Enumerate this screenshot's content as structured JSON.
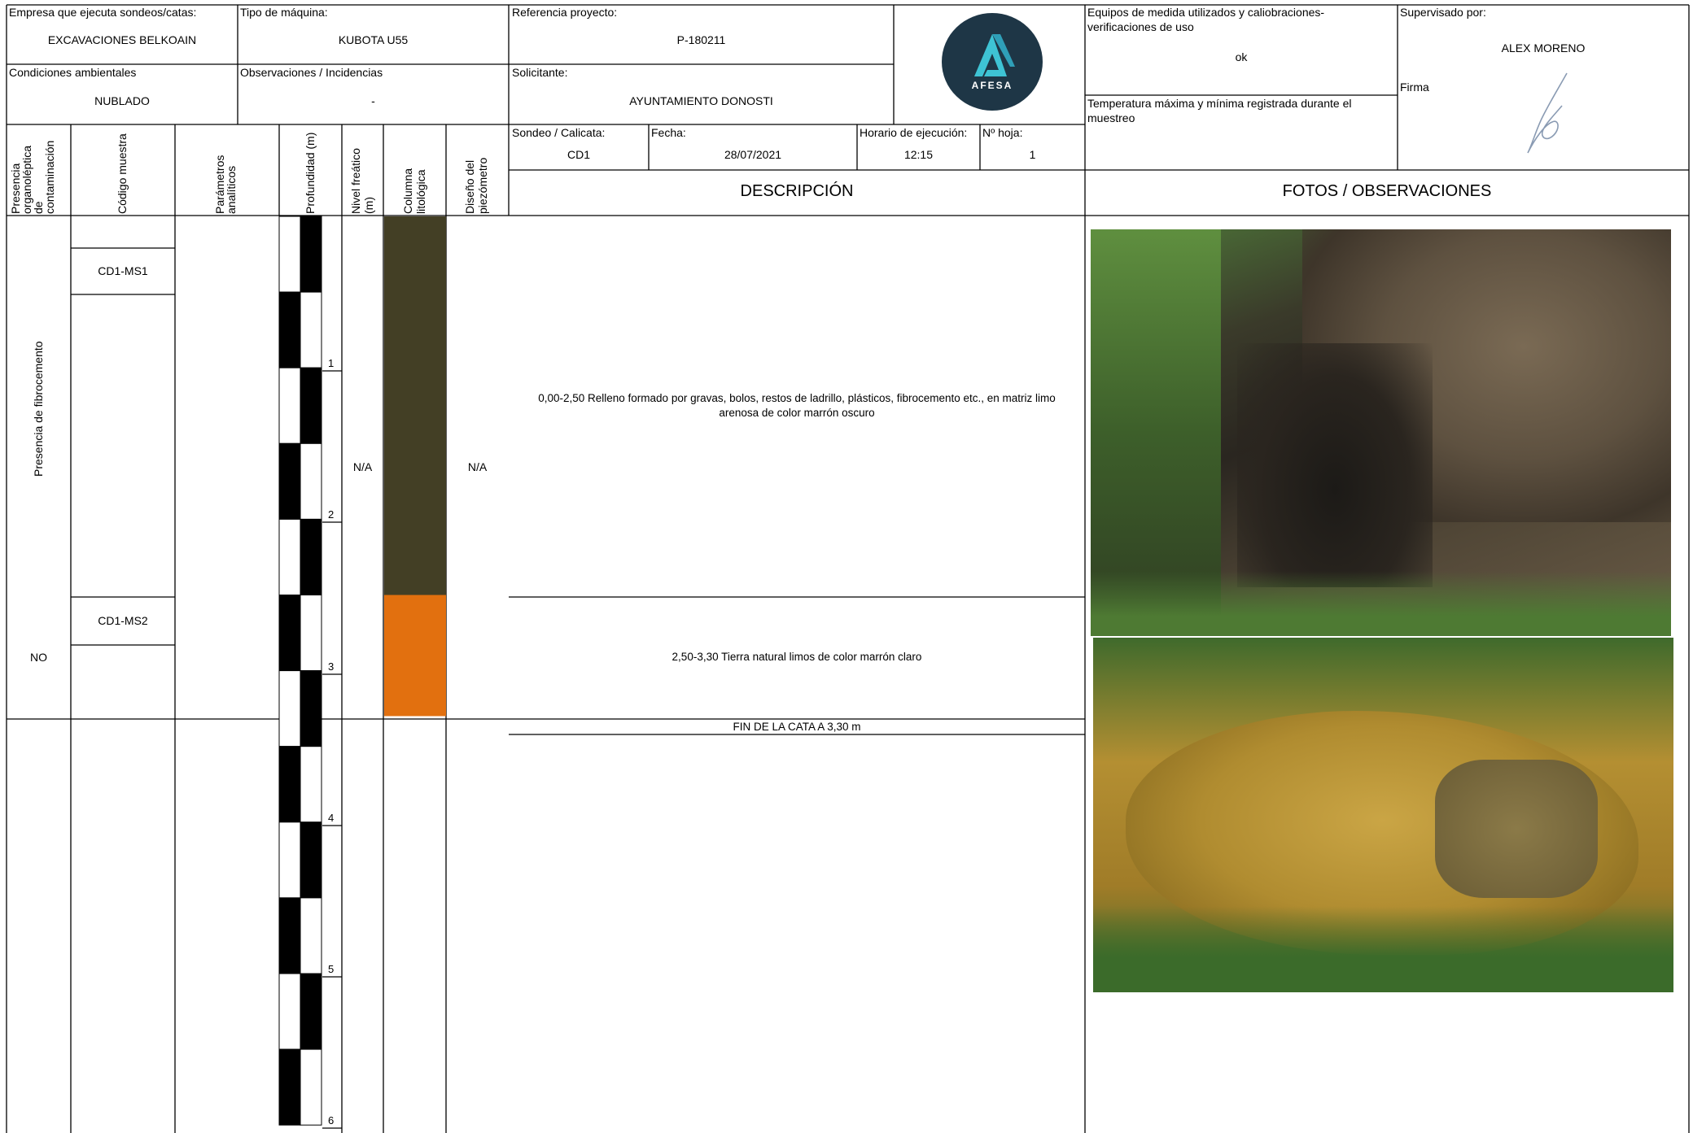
{
  "header": {
    "empresa_label": "Empresa que ejecuta sondeos/catas:",
    "empresa_value": "EXCAVACIONES BELKOAIN",
    "maquina_label": "Tipo de máquina:",
    "maquina_value": "KUBOTA U55",
    "referencia_label": "Referencia proyecto:",
    "referencia_value": "P-180211",
    "equipos_label_1": "Equipos de medida utilizados y caliobraciones-",
    "equipos_label_2": "verificaciones de uso",
    "equipos_value": "ok",
    "supervisado_label": "Supervisado por:",
    "supervisado_value": "ALEX MORENO",
    "condiciones_label": "Condiciones ambientales",
    "condiciones_value": "NUBLADO",
    "observaciones_label": "Observaciones / Incidencias",
    "observaciones_value": "-",
    "solicitante_label": "Solicitante:",
    "solicitante_value": "AYUNTAMIENTO DONOSTI",
    "firma_label": "Firma",
    "temperatura_label_1": "Temperatura máxima y mínima registrada durante el",
    "temperatura_label_2": "muestreo",
    "sondeo_label": "Sondeo / Calicata:",
    "sondeo_value": "CD1",
    "fecha_label": "Fecha:",
    "fecha_value": "28/07/2021",
    "horario_label": "Horario de ejecución:",
    "horario_value": "12:15",
    "hoja_label": "Nº hoja:",
    "hoja_value": "1",
    "logo_text": "AFESA"
  },
  "columns": {
    "presencia_1": "Presencia",
    "presencia_2": "organoléptica",
    "presencia_3": "de",
    "presencia_4": "contaminación",
    "codigo": "Código muestra",
    "parametros_1": "Parámetros",
    "parametros_2": "analíticos",
    "profundidad": "Profundidad (m)",
    "nivel_1": "Nivel freático",
    "nivel_2": "(m)",
    "columna_1": "Columna",
    "columna_2": "litológica",
    "diseno_1": "Diseño del",
    "diseno_2": "piezómetro",
    "descripcion": "DESCRIPCIÓN",
    "fotos": "FOTOS / OBSERVACIONES"
  },
  "log": {
    "presencia_fibro": "Presencia de fibrocemento",
    "presencia_no": "NO",
    "muestra_1": "CD1-MS1",
    "muestra_2": "CD1-MS2",
    "nivel_freatico": "N/A",
    "piezometro": "N/A",
    "depth_labels": [
      "1",
      "2",
      "3",
      "4",
      "5",
      "6"
    ],
    "desc_1_line_1": "0,00-2,50 Relleno formado por gravas, bolos, restos de ladrillo, plásticos, fibrocemento etc., en matriz limo",
    "desc_1_line_2": "arenosa de color marrón oscuro",
    "desc_2": "2,50-3,30 Tierra natural limos de color marrón claro",
    "fin": "FIN DE LA CATA A 3,30 m"
  },
  "layers": [
    {
      "from_m": 0.0,
      "to_m": 2.5,
      "color": "#433f25"
    },
    {
      "from_m": 2.5,
      "to_m": 3.3,
      "color": "#e2700f"
    }
  ],
  "colors": {
    "logo_bg": "#1e3646",
    "logo_accent": "#3ec3d4",
    "rule": "#000000"
  }
}
